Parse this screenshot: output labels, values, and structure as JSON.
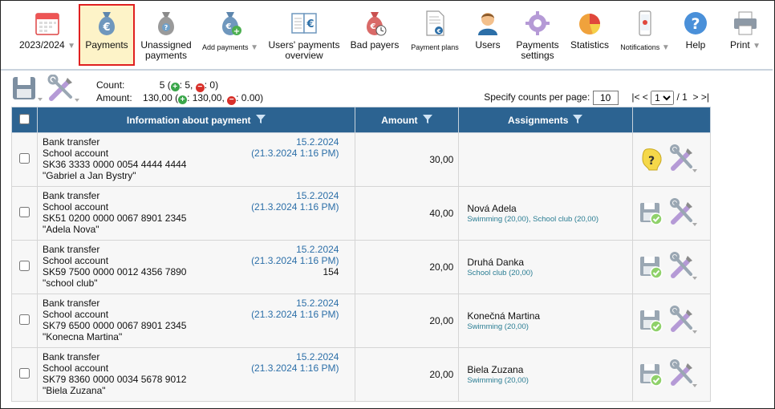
{
  "toolbar": {
    "year": "2023/2024",
    "payments": "Payments",
    "unassigned_line1": "Unassigned",
    "unassigned_line2": "payments",
    "add_payments": "Add payments",
    "users_overview_line1": "Users' payments",
    "users_overview_line2": "overview",
    "bad_payers": "Bad payers",
    "payment_plans": "Payment plans",
    "users": "Users",
    "settings_line1": "Payments",
    "settings_line2": "settings",
    "statistics": "Statistics",
    "notifications": "Notifications",
    "help": "Help",
    "print": "Print",
    "accent": "#e02020"
  },
  "summary": {
    "count_label": "Count:",
    "count_value": "5 (",
    "count_plus": ": 5, ",
    "count_minus": ": 0)",
    "amount_label": "Amount:",
    "amount_value": "130,00 (",
    "amount_plus": ": 130,00, ",
    "amount_minus": ": 0.00)"
  },
  "pager": {
    "per_page_label": "Specify counts per page:",
    "per_page_value": "10",
    "first": "|<",
    "prev": "<",
    "page": "1",
    "of": "/ 1",
    "next": ">",
    "last": ">|"
  },
  "table": {
    "headers": {
      "info": "Information about payment",
      "amount": "Amount",
      "assignments": "Assignments"
    },
    "header_bg": "#2c6391",
    "rows": [
      {
        "type": "Bank transfer",
        "account": "School account",
        "iban": "SK36 3333 0000 0054 4444 4444",
        "name": "\"Gabriel a Jan Bystry\"",
        "date": "15.2.2024",
        "date2": "(21.3.2024 1:16 PM)",
        "note": "",
        "amount": "30,00",
        "assignee": "",
        "assignment_detail": "",
        "status_icon": "unknown-icon"
      },
      {
        "type": "Bank transfer",
        "account": "School account",
        "iban": "SK51 0200 0000 0067 8901 2345",
        "name": "\"Adela Nova\"",
        "date": "15.2.2024",
        "date2": "(21.3.2024 1:16 PM)",
        "note": "",
        "amount": "40,00",
        "assignee": "Nová Adela",
        "assignment_detail": "Swimming (20,00), School club (20,00)",
        "status_icon": "save-ok-icon"
      },
      {
        "type": "Bank transfer",
        "account": "School account",
        "iban": "SK59 7500 0000 0012 4356 7890",
        "name": "\"school club\"",
        "date": "15.2.2024",
        "date2": "(21.3.2024 1:16 PM)",
        "note": "154",
        "amount": "20,00",
        "assignee": "Druhá Danka",
        "assignment_detail": "School club (20,00)",
        "status_icon": "save-ok-icon"
      },
      {
        "type": "Bank transfer",
        "account": "School account",
        "iban": "SK79 6500 0000 0067 8901 2345",
        "name": "\"Konecna Martina\"",
        "date": "15.2.2024",
        "date2": "(21.3.2024 1:16 PM)",
        "note": "",
        "amount": "20,00",
        "assignee": "Konečná Martina",
        "assignment_detail": "Swimming (20,00)",
        "status_icon": "save-ok-icon"
      },
      {
        "type": "Bank transfer",
        "account": "School account",
        "iban": "SK79 8360 0000 0034 5678 9012",
        "name": "\"Biela Zuzana\"",
        "date": "15.2.2024",
        "date2": "(21.3.2024 1:16 PM)",
        "note": "",
        "amount": "20,00",
        "assignee": "Biela Zuzana",
        "assignment_detail": "Swimming (20,00)",
        "status_icon": "save-ok-icon"
      }
    ]
  }
}
